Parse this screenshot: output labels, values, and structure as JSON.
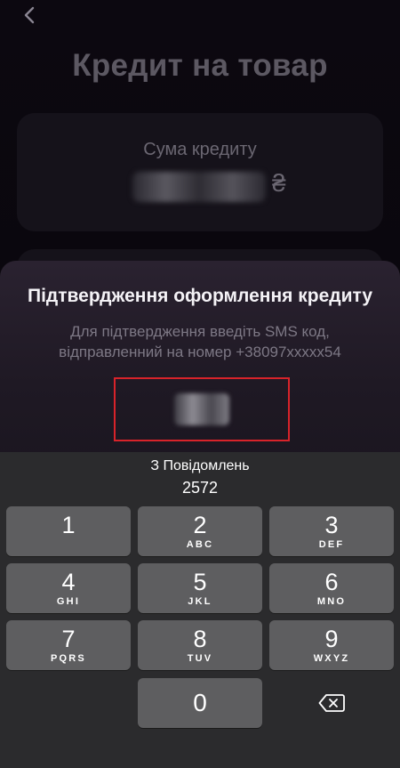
{
  "page": {
    "title": "Кредит на товар",
    "amount_label": "Сума кредиту",
    "currency": "₴"
  },
  "sheet": {
    "title": "Підтвердження оформлення кредиту",
    "description": "Для підтвердження введіть SMS код, відправленний на номер +38097xxxxx54"
  },
  "keyboard": {
    "suggestion_from": "З Повідомлень",
    "suggestion_code": "2572",
    "keys": [
      {
        "digit": "1",
        "letters": ""
      },
      {
        "digit": "2",
        "letters": "ABC"
      },
      {
        "digit": "3",
        "letters": "DEF"
      },
      {
        "digit": "4",
        "letters": "GHI"
      },
      {
        "digit": "5",
        "letters": "JKL"
      },
      {
        "digit": "6",
        "letters": "MNO"
      },
      {
        "digit": "7",
        "letters": "PQRS"
      },
      {
        "digit": "8",
        "letters": "TUV"
      },
      {
        "digit": "9",
        "letters": "WXYZ"
      },
      {
        "digit": "0",
        "letters": ""
      }
    ]
  },
  "colors": {
    "highlight_border": "#d8232a",
    "key_background": "#5e5e60",
    "keyboard_background": "#2b2b2d"
  }
}
